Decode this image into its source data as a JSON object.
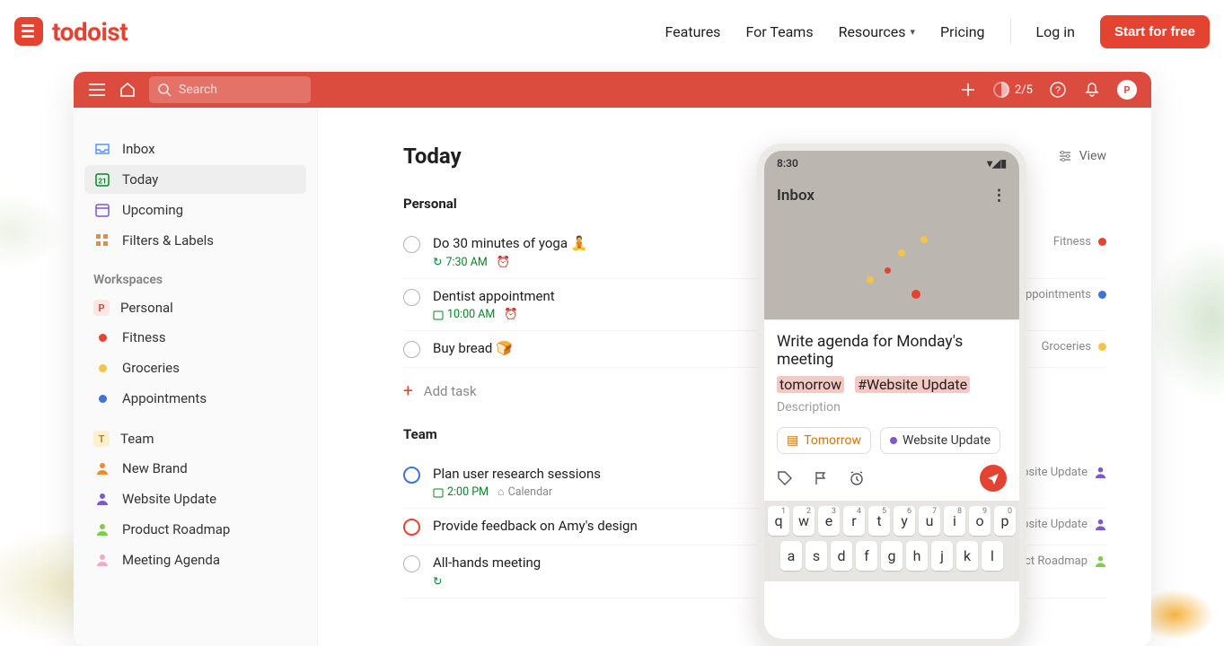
{
  "nav": {
    "brand": "todoist",
    "links": {
      "features": "Features",
      "teams": "For Teams",
      "resources": "Resources",
      "pricing": "Pricing",
      "login": "Log in"
    },
    "cta": "Start for free"
  },
  "app": {
    "search_placeholder": "Search",
    "progress": "2/5",
    "avatar_initial": "P",
    "sidebar": {
      "nav": [
        "Inbox",
        "Today",
        "Upcoming",
        "Filters & Labels"
      ],
      "workspaces_label": "Workspaces",
      "personal_group": [
        {
          "label": "Personal",
          "badge": "P",
          "badge_bg": "#fce7e5",
          "badge_fg": "#e44332"
        },
        {
          "label": "Fitness",
          "dot": "#e44332"
        },
        {
          "label": "Groceries",
          "dot": "#f5c443"
        },
        {
          "label": "Appointments",
          "dot": "#4073d6"
        }
      ],
      "team_group_header": {
        "label": "Team",
        "badge": "T",
        "badge_bg": "#fbf0d0",
        "badge_fg": "#b38a1f"
      },
      "team_group": [
        {
          "label": "New Brand",
          "person": "#ed8b33"
        },
        {
          "label": "Website Update",
          "person": "#7b57d1"
        },
        {
          "label": "Product Roadmap",
          "person": "#7ecc49"
        },
        {
          "label": "Meeting Agenda",
          "person": "#f4a9c8"
        }
      ]
    },
    "main": {
      "title": "Today",
      "view_label": "View",
      "add_task": "Add task",
      "sections": [
        {
          "title": "Personal",
          "tasks": [
            {
              "title": "Do 30 minutes of yoga 🧘",
              "time": "7:30 AM",
              "recur": true,
              "alarm": true,
              "tag": "Fitness",
              "tag_color": "#e44332"
            },
            {
              "title": "Dentist appointment",
              "time": "10:00 AM",
              "date": true,
              "alarm": true,
              "tag": "Appointments",
              "tag_color": "#4073d6"
            },
            {
              "title": "Buy bread 🍞",
              "tag": "Groceries",
              "tag_color": "#f5c443"
            }
          ]
        },
        {
          "title": "Team",
          "tasks": [
            {
              "title": "Plan user research sessions",
              "time": "2:00 PM",
              "date": true,
              "calendar": "Calendar",
              "tag": "Website Update",
              "priority": "p3",
              "avatar": true
            },
            {
              "title": "Provide feedback on Amy's design",
              "priority": "p2",
              "tag": "Website Update",
              "avatar": true
            },
            {
              "title": "All-hands meeting",
              "recur": true,
              "tag": "Product Roadmap",
              "avatar": true
            }
          ]
        }
      ]
    }
  },
  "phone": {
    "time": "8:30",
    "header": "Inbox",
    "task_text": "Write agenda for Monday's meeting",
    "hl1": "tomorrow",
    "hl2": "#Website Update",
    "description": "Description",
    "chip1": "Tomorrow",
    "chip2": "Website Update",
    "keyboard": {
      "row1": [
        [
          "q",
          "1"
        ],
        [
          "w",
          "2"
        ],
        [
          "e",
          "3"
        ],
        [
          "r",
          "4"
        ],
        [
          "t",
          "5"
        ],
        [
          "y",
          "6"
        ],
        [
          "u",
          "7"
        ],
        [
          "i",
          "8"
        ],
        [
          "o",
          "9"
        ],
        [
          "p",
          "0"
        ]
      ],
      "row2": [
        "a",
        "s",
        "d",
        "f",
        "g",
        "h",
        "j",
        "k",
        "l"
      ]
    }
  }
}
